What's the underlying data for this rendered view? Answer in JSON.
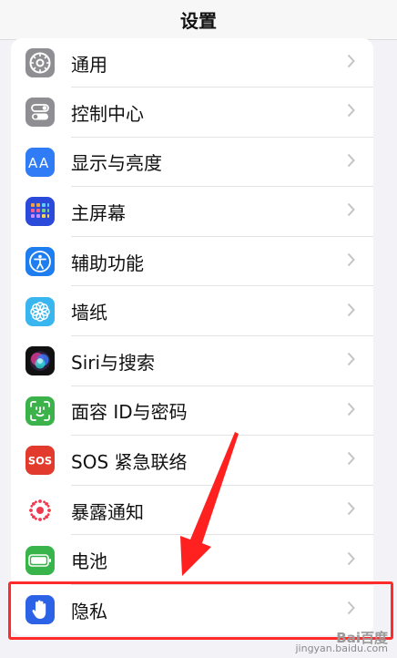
{
  "header": {
    "title": "设置"
  },
  "items": [
    {
      "label": "通用",
      "icon": "gear-icon",
      "color": "#8e8e93"
    },
    {
      "label": "控制中心",
      "icon": "toggles-icon",
      "color": "#8e8e93"
    },
    {
      "label": "显示与亮度",
      "icon": "text-size-icon",
      "color": "#2f7cf6"
    },
    {
      "label": "主屏幕",
      "icon": "home-screen-grid-icon",
      "color": "#2c4ad9"
    },
    {
      "label": "辅助功能",
      "icon": "accessibility-person-icon",
      "color": "#1e7ef0"
    },
    {
      "label": "墙纸",
      "icon": "flower-icon",
      "color": "#39b6f0"
    },
    {
      "label": "Siri与搜索",
      "icon": "siri-icon",
      "color": "#111111"
    },
    {
      "label": "面容 ID与密码",
      "icon": "face-id-icon",
      "color": "#3bb34a"
    },
    {
      "label": "SOS 紧急联络",
      "icon": "sos-icon",
      "color": "#e23b2e"
    },
    {
      "label": "暴露通知",
      "icon": "exposure-dots-icon",
      "color": "#ffffff"
    },
    {
      "label": "电池",
      "icon": "battery-icon",
      "color": "#38b44a"
    },
    {
      "label": "隐私",
      "icon": "hand-icon",
      "color": "#2c62e6"
    }
  ],
  "annotation": {
    "frame_color": "#ff2a2a"
  },
  "watermark": {
    "logo": "Bai百度",
    "url": "jingyan.baidu.com"
  }
}
